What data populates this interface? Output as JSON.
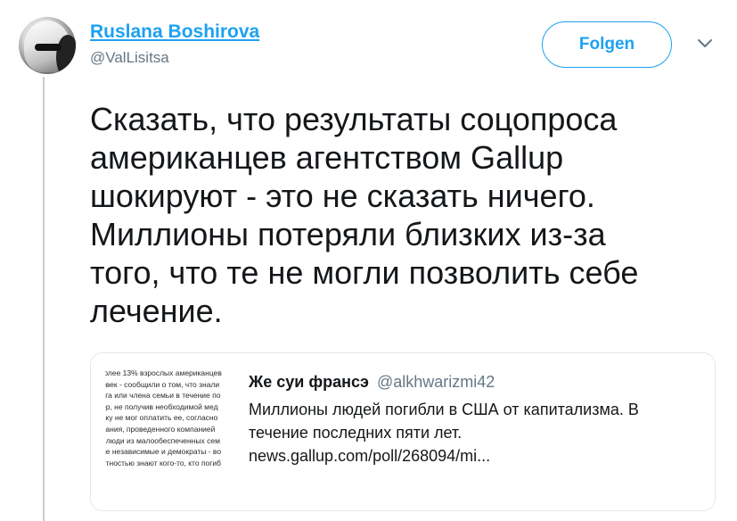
{
  "tweet": {
    "author": {
      "display_name": "Ruslana Boshirova",
      "handle": "@ValLisitsa"
    },
    "follow_label": "Folgen",
    "text": "Сказать, что результаты соцопроса\nамериканцев агентством Gallup\nшокируют - это не сказать ничего.\nМиллионы потеряли близких из-за\nтого, что те не могли позволить себе\nлечение."
  },
  "quote": {
    "author": "Же суи франсэ",
    "handle": "@alkhwarizmi42",
    "text": "Миллионы людей погибли в США от капитализма. В\nтечение последних пяти лет.\nnews.gallup.com/poll/268094/mi...",
    "thumbnail_lines": [
      ".олее 13% взрослых американцев",
      "овек - сообщили о том, что знали",
      "уга или члена семьи в течение по",
      "ер, не получив необходимой мед",
      "ьку не мог оплатить ее, согласно",
      "вания, проведенного компанией",
      ", люди из малообеспеченных сем",
      "ие независимые и демократы - во",
      "ятностью знают кого-то, кто погиб",
      "ι."
    ]
  },
  "icons": {
    "caret": "chevron-down-icon",
    "avatar": "user-avatar"
  },
  "colors": {
    "accent": "#1da1f2",
    "secondary_text": "#657786",
    "border": "#e1e8ed",
    "thread_line": "#c4cfd6"
  }
}
